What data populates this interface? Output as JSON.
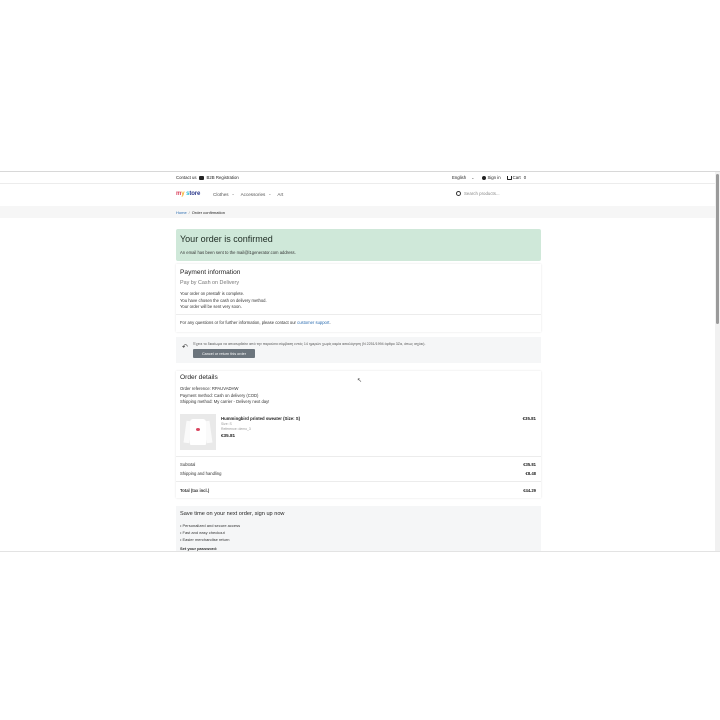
{
  "topbar": {
    "contact": "Contact us",
    "b2b": "B2B Registration",
    "language": "English",
    "sign_in": "Sign in",
    "cart": "Cart",
    "cart_count": "0"
  },
  "header": {
    "logo": {
      "m": "m",
      "y": "y",
      "s": "s",
      "rest": "tore"
    },
    "nav": [
      "Clothes",
      "Accessories",
      "Art"
    ],
    "search_placeholder": "Search products..."
  },
  "breadcrumb": {
    "home": "Home",
    "current": "Order confirmation"
  },
  "confirmation": {
    "title": "Your order is confirmed",
    "subtitle": "An email has been sent to the mail@l1generator.com address."
  },
  "payment": {
    "title": "Payment information",
    "method": "Pay by Cash on Delivery",
    "lines": [
      "Your order on prestafr is complete.",
      "You have chosen the cash on delivery method.",
      "Your order will be sent very soon."
    ],
    "contact_pre": "For any questions or for further information, please contact our",
    "contact_link": "customer support",
    "contact_post": "."
  },
  "cancel": {
    "text": "Έχετε το δικαίωμα να αποσυρθείτε από την παρούσα σύμβαση εντός 14 ημερών χωρίς καμία αιτιολόγηση (N 2251/1994 άρθρο 3Ζα, όπως ισχύει).",
    "button": "Cancel or return this order"
  },
  "order_details": {
    "title": "Order details",
    "reference": "Order reference: RPAUVADHW",
    "payment_method": "Payment method: Cash on delivery (COD)",
    "shipping_method": "Shipping method: My carrier - Delivery next day!",
    "product": {
      "name": "Hummingbird printed sweater (Size: S)",
      "size": "Size: S",
      "reference": "Reference: demo_3",
      "unit_price": "€35.81",
      "total": "€35.81"
    },
    "subtotal_label": "Subtotal",
    "subtotal_value": "€35.81",
    "shipping_label": "Shipping and handling",
    "shipping_value": "€8.48",
    "total_label": "Total (tax incl.)",
    "total_value": "€44.29"
  },
  "signup": {
    "title": "Save time on your next order, sign up now",
    "bullets": [
      "Personalized and secure access",
      "Fast and easy checkout",
      "Easier merchandise return"
    ],
    "password_label": "Set your password:"
  },
  "colors": {
    "confirm_bg": "#cfe8d9",
    "link": "#2b6cb0",
    "button_bg": "#6c757d"
  }
}
